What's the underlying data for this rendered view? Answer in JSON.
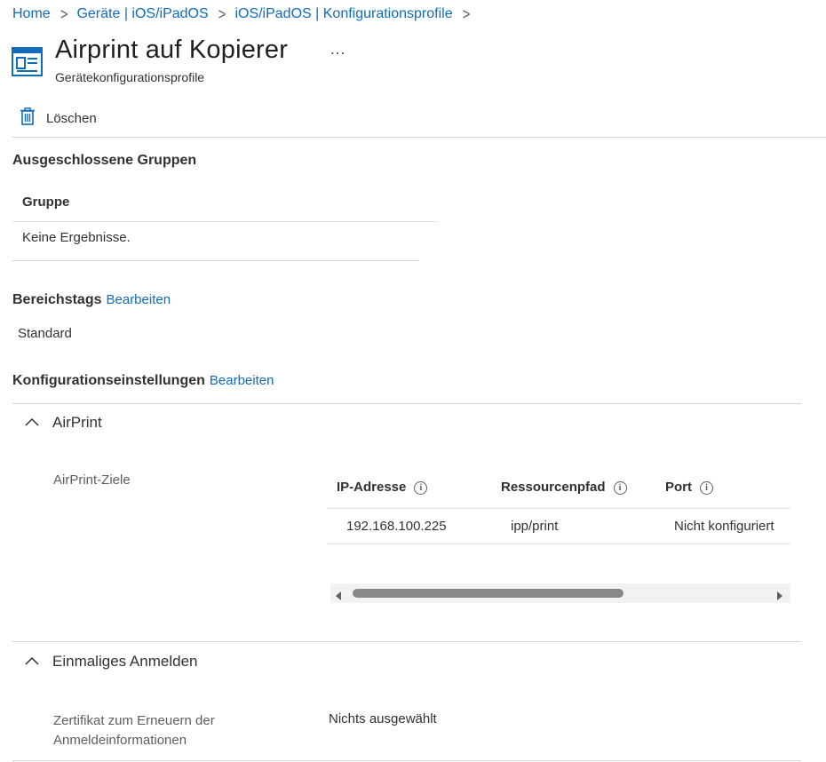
{
  "breadcrumb": {
    "items": [
      "Home",
      "Geräte | iOS/iPadOS",
      "iOS/iPadOS | Konfigurationsprofile"
    ],
    "separator": ">"
  },
  "header": {
    "title": "Airprint auf Kopierer",
    "more": "...",
    "subtitle": "Gerätekonfigurationsprofile",
    "icon": "profile-card-icon"
  },
  "toolbar": {
    "delete_label": "Löschen",
    "delete_icon": "trash-icon"
  },
  "excluded_groups": {
    "title": "Ausgeschlossene Gruppen",
    "column": "Gruppe",
    "empty": "Keine Ergebnisse."
  },
  "scope_tags": {
    "title": "Bereichstags",
    "edit": "Bearbeiten",
    "value": "Standard"
  },
  "config_settings": {
    "title": "Konfigurationseinstellungen",
    "edit": "Bearbeiten"
  },
  "airprint": {
    "heading": "AirPrint",
    "field_label": "AirPrint-Ziele",
    "columns": [
      "IP-Adresse",
      "Ressourcenpfad",
      "Port"
    ],
    "info_glyph": "i",
    "rows": [
      [
        "192.168.100.225",
        "ipp/print",
        "Nicht konfiguriert"
      ]
    ]
  },
  "sso": {
    "heading": "Einmaliges Anmelden",
    "field_label_line1": "Zertifikat zum Erneuern der",
    "field_label_line2": "Anmeldeinformationen",
    "value": "Nichts ausgewählt"
  },
  "colors": {
    "link": "#0f6cbd",
    "text": "#323130",
    "muted": "#605e5c",
    "divider": "#d6d6d6",
    "scroll_thumb": "#8a8886",
    "scroll_track": "#f3f2f1"
  }
}
